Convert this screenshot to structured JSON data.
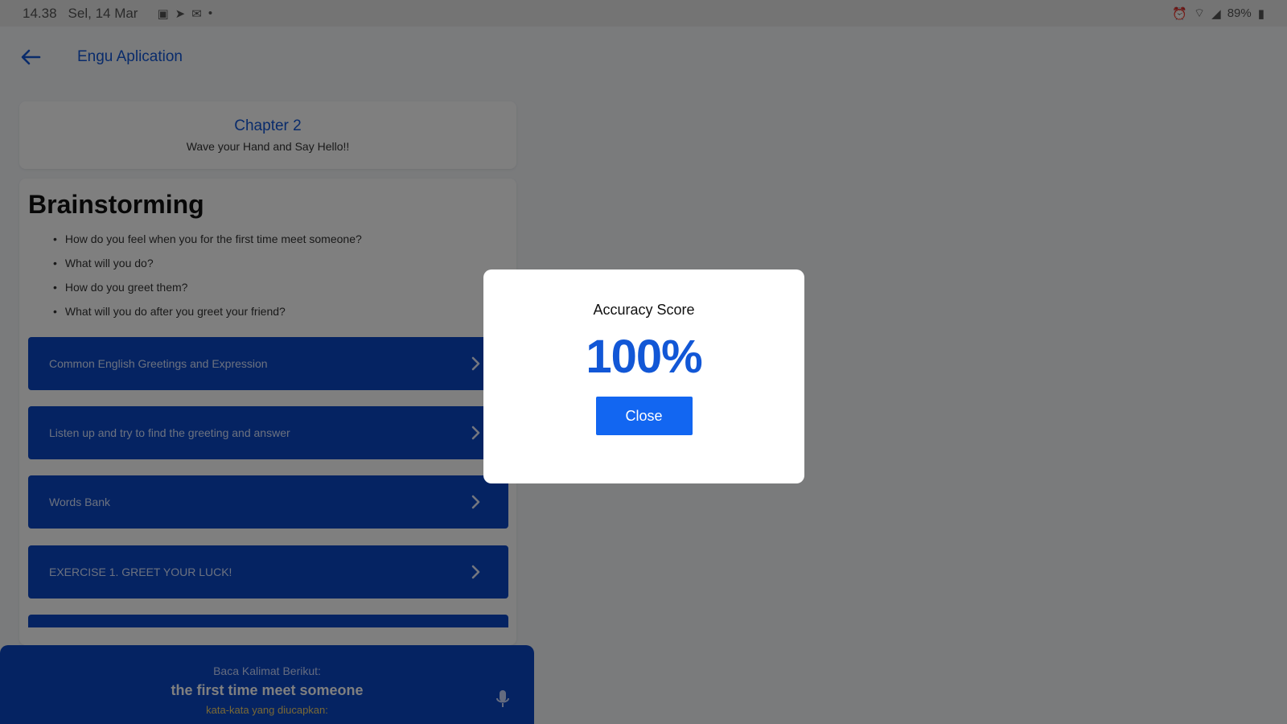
{
  "status_bar": {
    "time": "14.38",
    "date": "Sel, 14 Mar",
    "battery": "89%"
  },
  "app_bar": {
    "title": "Engu Aplication"
  },
  "chapter": {
    "title": "Chapter 2",
    "subtitle": "Wave your Hand and Say Hello!!"
  },
  "brainstorming": {
    "title": "Brainstorming",
    "questions": [
      "How do you feel when you for the first time meet someone?",
      "What will you do?",
      "How do you greet them?",
      "What will you do after you greet your friend?"
    ]
  },
  "menu_items": [
    "Common English Greetings and Expression",
    "Listen up and try to find the greeting and answer",
    "Words Bank",
    "EXERCISE 1. GREET YOUR LUCK!"
  ],
  "speech_panel": {
    "instruction": "Baca Kalimat Berikut:",
    "sentence": "the first time meet someone",
    "hint": "kata-kata yang diucapkan:"
  },
  "dialog": {
    "title": "Accuracy Score",
    "score": "100%",
    "close_label": "Close"
  },
  "colors": {
    "primary": "#1257d6",
    "button_blue": "#0b47c4",
    "close_blue": "#1266f1",
    "hint_yellow": "#f2d16b"
  }
}
